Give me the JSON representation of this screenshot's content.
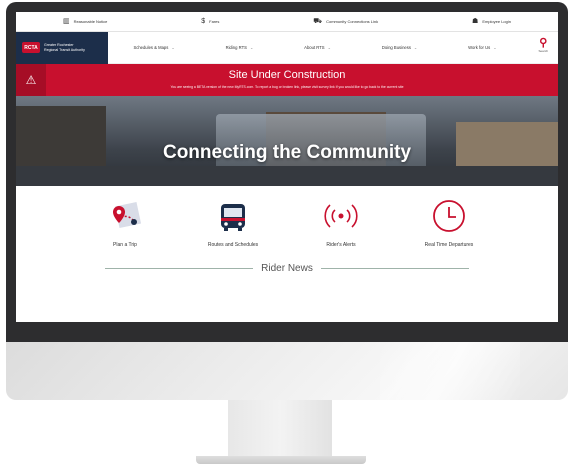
{
  "utility": {
    "items": [
      {
        "label": "Reasonable Notice",
        "icon": "building-icon"
      },
      {
        "label": "Fares",
        "icon": "dollar-icon"
      },
      {
        "label": "Community Connections Link",
        "icon": "bus-car-icon"
      },
      {
        "label": "Employee Login",
        "icon": "user-icon"
      }
    ]
  },
  "brand": {
    "logo": "RCTA",
    "name_line1": "Greater Rochester",
    "name_line2": "Regional Transit Authority"
  },
  "nav": {
    "items": [
      "Schedules & Maps",
      "Riding RTS",
      "About RTS",
      "Doing Business",
      "Work for Us"
    ],
    "search_label": "Search"
  },
  "alert": {
    "title": "Site Under Construction",
    "text": "You are seeing a BETA version of the new MyRTS.com. To report a bug or broken link, please visit  survey link  If you would like to go back to the current site",
    "icon": "warning-icon"
  },
  "hero": {
    "title": "Connecting the Community"
  },
  "quick_links": [
    {
      "label": "Plan a Trip",
      "icon": "map-pin-icon"
    },
    {
      "label": "Routes and Schedules",
      "icon": "bus-icon"
    },
    {
      "label": "Rider's Alerts",
      "icon": "broadcast-icon"
    },
    {
      "label": "Real Time Departures",
      "icon": "clock-icon"
    }
  ],
  "news": {
    "title": "Rider News"
  },
  "colors": {
    "accent": "#c8102e",
    "navy": "#1c2e4a"
  }
}
